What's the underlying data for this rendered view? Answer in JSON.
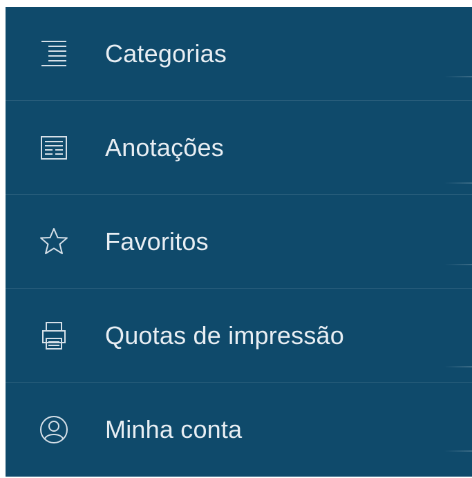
{
  "menu": {
    "items": [
      {
        "label": "Categorias",
        "icon": "categories-icon"
      },
      {
        "label": "Anotações",
        "icon": "notes-icon"
      },
      {
        "label": "Favoritos",
        "icon": "star-icon"
      },
      {
        "label": "Quotas de impressão",
        "icon": "printer-icon"
      },
      {
        "label": "Minha conta",
        "icon": "user-icon"
      }
    ]
  },
  "colors": {
    "background": "#0f4a6b",
    "text": "#e8eef3",
    "icon": "#d6e0e8"
  }
}
